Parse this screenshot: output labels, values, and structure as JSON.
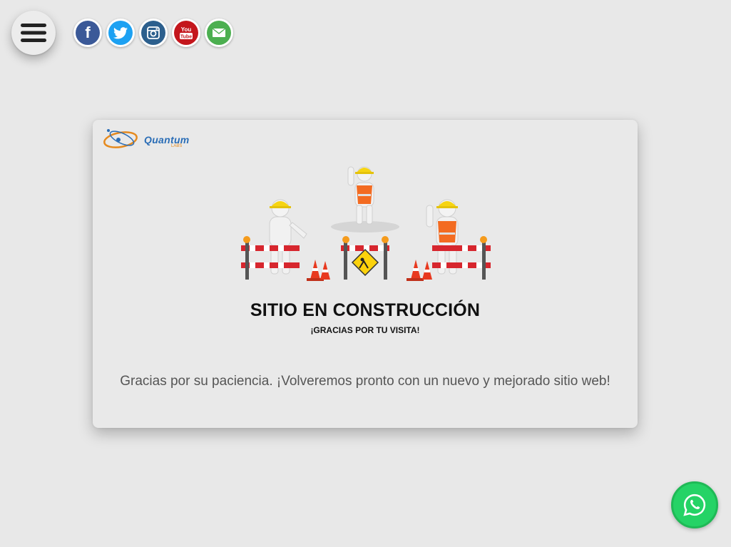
{
  "menu": {
    "icon": "hamburger-icon"
  },
  "social": [
    {
      "name": "facebook",
      "icon": "facebook-icon",
      "glyph": "f",
      "color": "#3b5998"
    },
    {
      "name": "twitter",
      "icon": "twitter-icon",
      "glyph": "",
      "color": "#1da1f2"
    },
    {
      "name": "instagram",
      "icon": "instagram-icon",
      "glyph": "",
      "color": "#2c5f8d"
    },
    {
      "name": "youtube",
      "icon": "youtube-icon",
      "glyph": "You Tube",
      "color": "#c4161c"
    },
    {
      "name": "email",
      "icon": "email-icon",
      "glyph": "",
      "color": "#4caf50"
    }
  ],
  "card": {
    "logo_text": "Quantum",
    "logo_sub": "LABS",
    "illustration": "under-construction-workers-illustration",
    "title": "SITIO EN CONSTRUCCIÓN",
    "subtitle": "¡GRACIAS POR TU VISITA!",
    "message": "Gracias por su paciencia. ¡Volveremos pronto con un nuevo y mejorado sitio web!"
  },
  "whatsapp": {
    "icon": "whatsapp-icon",
    "color": "#25d366"
  }
}
